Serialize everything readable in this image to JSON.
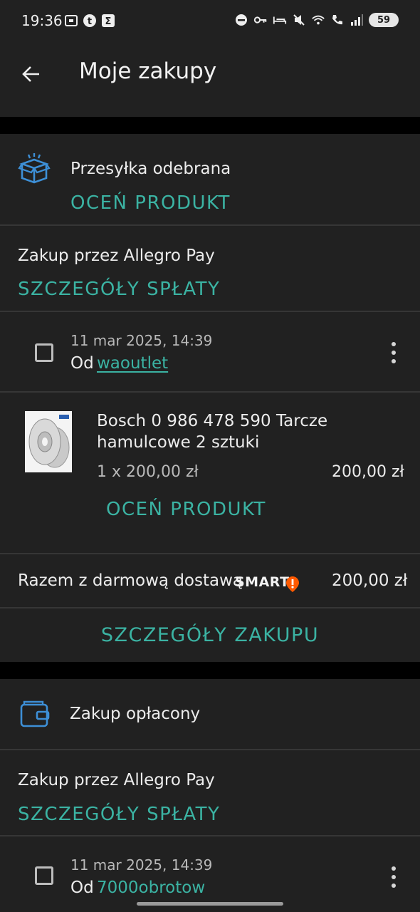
{
  "status_bar": {
    "time": "19:36",
    "battery": "59",
    "left_icons": [
      "screenshot-icon",
      "tumblr-icon",
      "sigma-app-icon"
    ],
    "right_icons": [
      "do-not-disturb-icon",
      "key-icon",
      "bed-icon",
      "mute-icon",
      "wifi-icon",
      "wifi-call-icon",
      "signal-icon"
    ]
  },
  "app_bar": {
    "title": "Moje zakupy"
  },
  "orders": [
    {
      "status": "Przesyłka odebrana",
      "status_icon": "box-icon",
      "rate_action": "OCEŃ PRODUKT",
      "payment_label": "Zakup przez Allegro Pay",
      "payment_action": "SZCZEGÓŁY SPŁATY",
      "date": "11 mar 2025, 14:39",
      "seller_prefix": "Od",
      "seller": "waoutlet",
      "item": {
        "name_line1": "Bosch 0 986 478 590 Tarcze",
        "name_line2": "hamulcowe 2 sztuki",
        "qty_price": "1 x 200,00 zł",
        "total": "200,00 zł",
        "rate_action": "OCEŃ PRODUKT"
      },
      "summary_label": "Razem z darmową dostawą",
      "smart_badge": "SMART",
      "summary_total": "200,00 zł",
      "details_action": "SZCZEGÓŁY ZAKUPU"
    },
    {
      "status": "Zakup opłacony",
      "status_icon": "wallet-icon",
      "payment_label": "Zakup przez Allegro Pay",
      "payment_action": "SZCZEGÓŁY SPŁATY",
      "date": "11 mar 2025, 14:39",
      "seller_prefix": "Od",
      "seller": "7000obrotow"
    }
  ],
  "colors": {
    "accent": "#3bb3a3",
    "icon_blue": "#3d8fd6",
    "smart_orange": "#ff5a00",
    "card_bg": "#212121",
    "page_bg": "#000000"
  }
}
